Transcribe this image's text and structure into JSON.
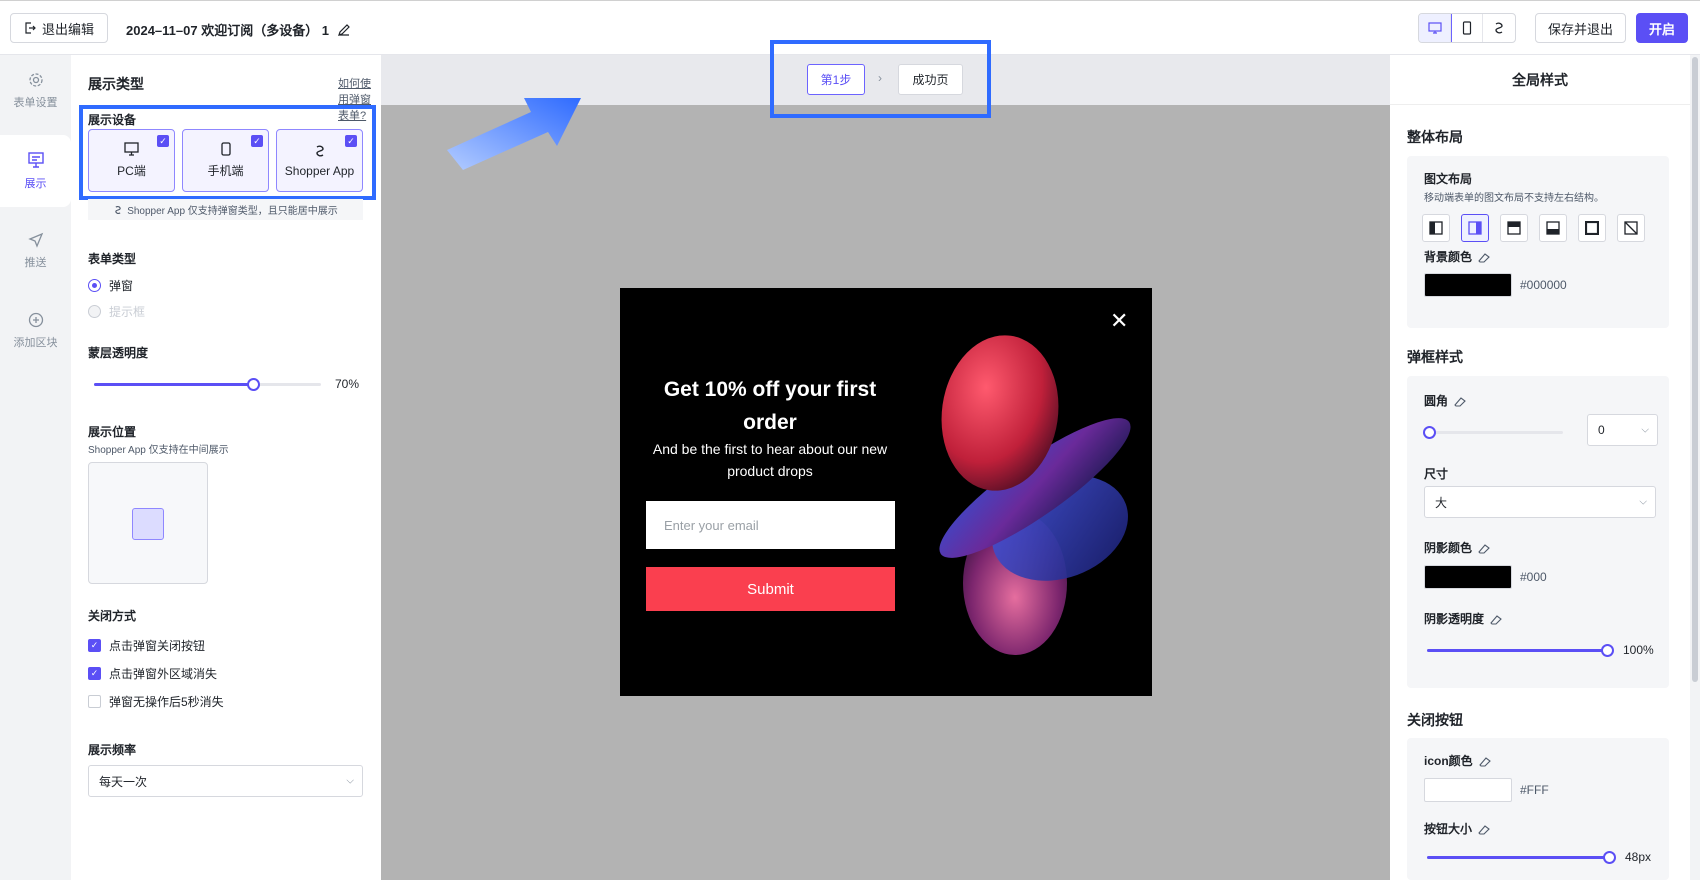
{
  "header": {
    "exit_label": "退出编辑",
    "title": "2024–11–07 欢迎订阅（多设备） 1",
    "save_label": "保存并退出",
    "open_label": "开启"
  },
  "nav": [
    {
      "label": "表单设置",
      "icon": "gear-icon"
    },
    {
      "label": "展示",
      "icon": "display-icon"
    },
    {
      "label": "推送",
      "icon": "send-icon"
    },
    {
      "label": "添加区块",
      "icon": "plus-circle-icon"
    }
  ],
  "left": {
    "heading": "展示类型",
    "help_link": "如何使用弹窗表单?",
    "device_label": "展示设备",
    "devices": [
      {
        "label": "PC端",
        "checked": true
      },
      {
        "label": "手机端",
        "checked": true
      },
      {
        "label": "Shopper App",
        "checked": true
      }
    ],
    "device_note": "Shopper App 仅支持弹窗类型，且只能居中展示",
    "form_type_label": "表单类型",
    "form_types": [
      "弹窗",
      "提示框"
    ],
    "opacity_label": "蒙层透明度",
    "opacity_value": "70%",
    "opacity_fraction": 0.7,
    "position_label": "展示位置",
    "position_note": "Shopper App 仅支持在中间展示",
    "close_label": "关闭方式",
    "close_options": [
      {
        "label": "点击弹窗关闭按钮",
        "checked": true
      },
      {
        "label": "点击弹窗外区域消失",
        "checked": true
      },
      {
        "label": "弹窗无操作后5秒消失",
        "checked": false
      }
    ],
    "freq_label": "展示频率",
    "freq_value": "每天一次"
  },
  "canvas": {
    "step1": "第1步",
    "step2": "成功页",
    "popup": {
      "title": "Get 10% off your first order",
      "subtitle": "And be the first to hear about  our new product drops",
      "email_placeholder": "Enter your email",
      "submit": "Submit"
    }
  },
  "right": {
    "panel_title": "全局样式",
    "layout_heading": "整体布局",
    "img_layout_label": "图文布局",
    "img_layout_note": "移动端表单的图文布局不支持左右结构。",
    "bg_color_label": "背景颜色",
    "bg_color": "#000000",
    "box_heading": "弹框样式",
    "radius_label": "圆角",
    "radius_value": "0",
    "size_label": "尺寸",
    "size_value": "大",
    "shadow_color_label": "阴影颜色",
    "shadow_color": "#000",
    "shadow_opacity_label": "阴影透明度",
    "shadow_opacity_value": "100%",
    "close_heading": "关闭按钮",
    "icon_color_label": "icon颜色",
    "icon_color": "#FFF",
    "btn_size_label": "按钮大小",
    "btn_size_value": "48px"
  },
  "colors": {
    "accent": "#5b4ff5",
    "highlight": "#2f6bff",
    "submit": "#fa3f4f"
  }
}
